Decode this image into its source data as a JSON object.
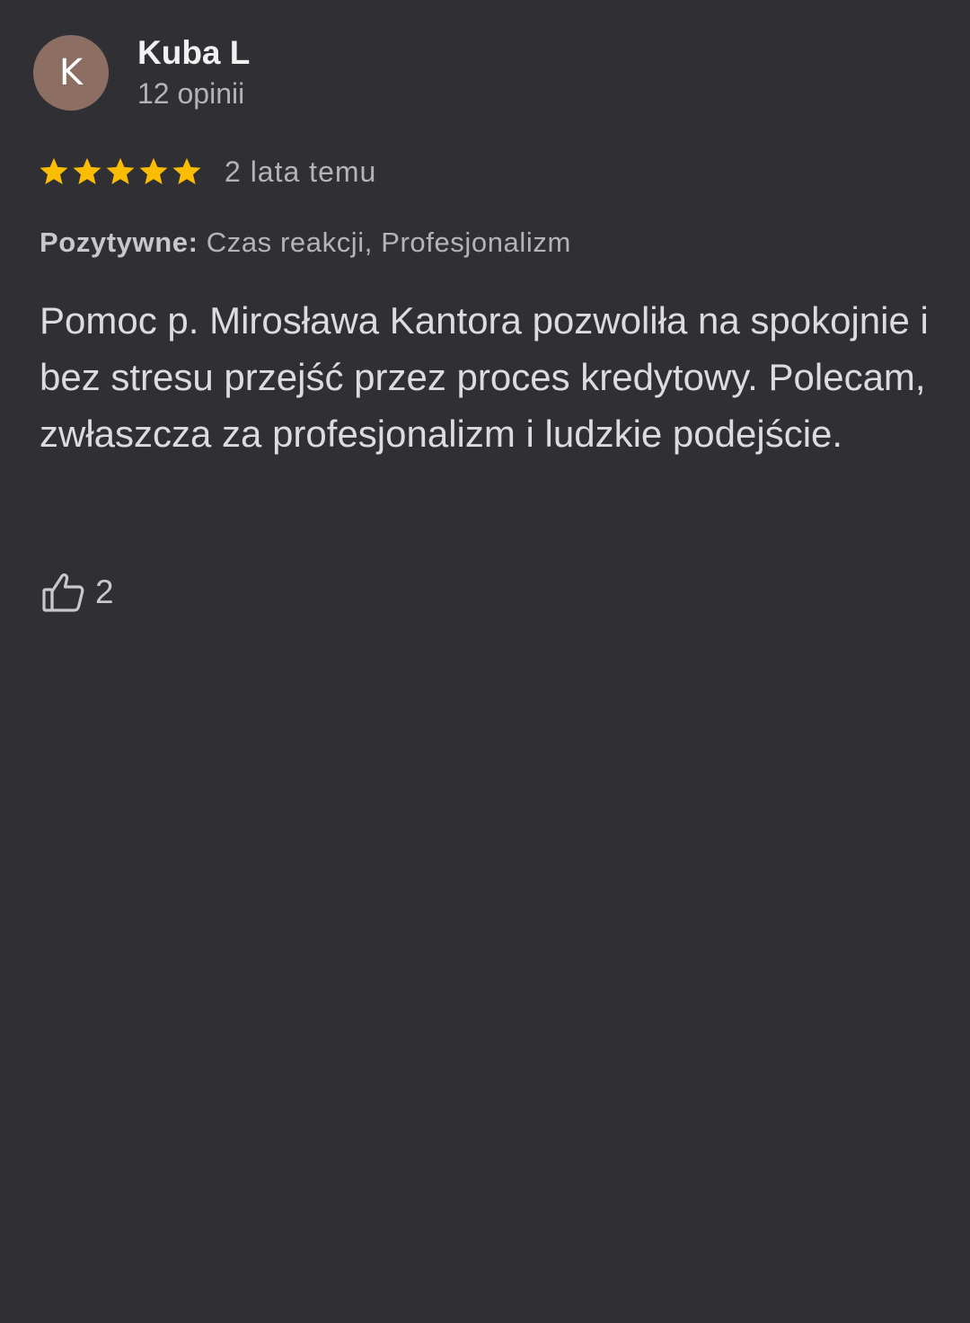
{
  "review": {
    "author": {
      "initial": "K",
      "name": "Kuba L",
      "meta": "12 opinii",
      "avatar_color": "#8d6e63"
    },
    "rating": {
      "stars": 5,
      "max_stars": 5,
      "star_color": "#fbbc04"
    },
    "date": "2 lata temu",
    "attributes": {
      "label": "Pozytywne:",
      "values": "Czas reakcji, Profesjonalizm"
    },
    "text": "Pomoc p. Mirosława Kantora pozwoliła na spokojnie i bez stresu przejść przez proces kredytowy. Polecam, zwłaszcza za profesjonalizm i ludzkie podejście.",
    "likes": {
      "icon": "thumb-up-icon",
      "count": "2"
    }
  },
  "colors": {
    "background": "#303034",
    "primary_text": "#f1f1f1",
    "secondary_text": "#b4b4b8"
  }
}
